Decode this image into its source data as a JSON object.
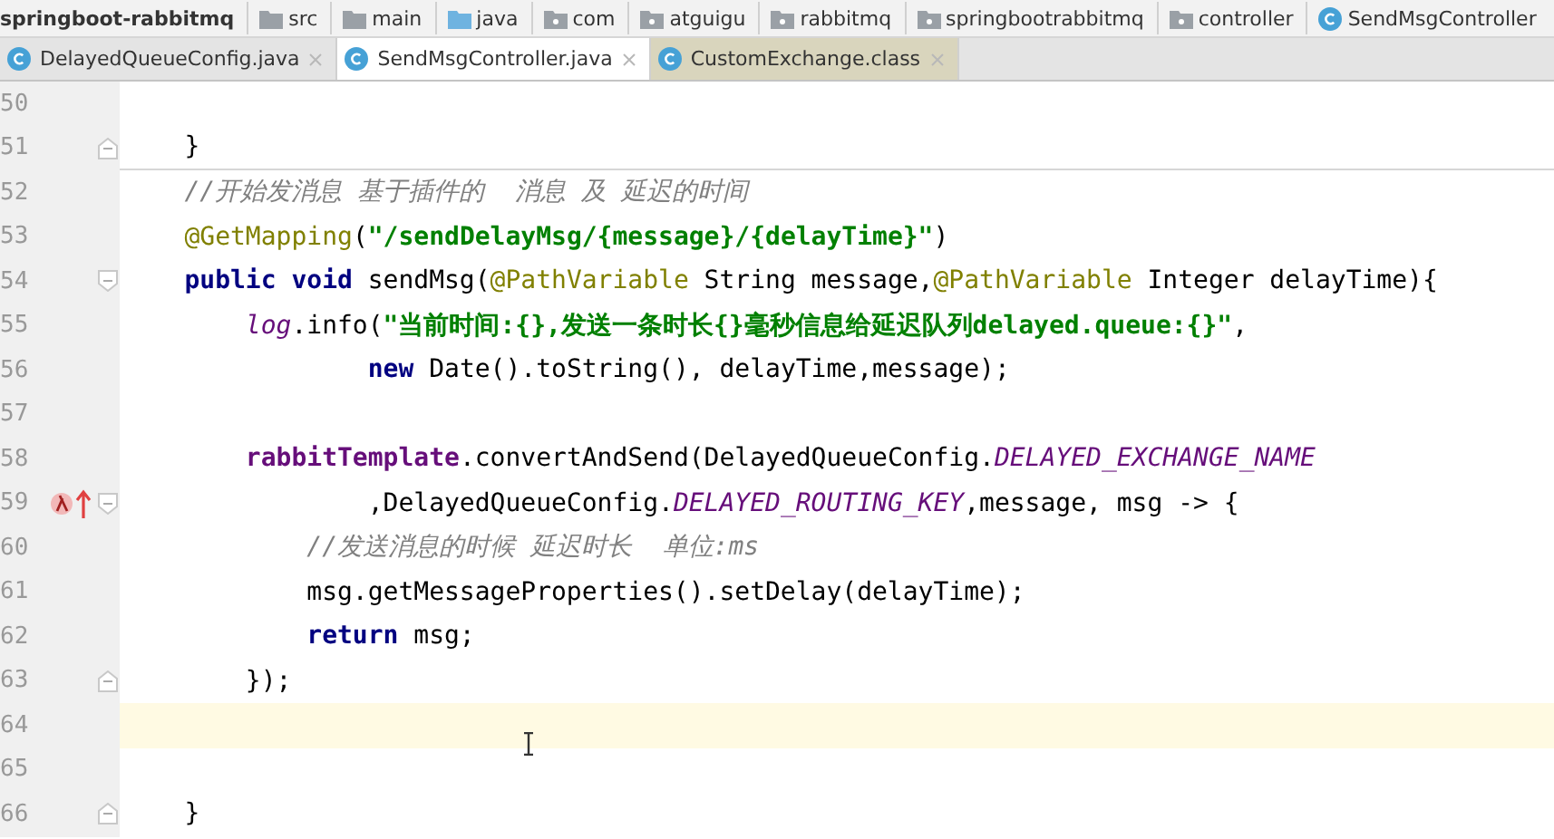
{
  "breadcrumb": [
    {
      "label": "springboot-rabbitmq",
      "kind": "project"
    },
    {
      "label": "src",
      "kind": "folder"
    },
    {
      "label": "main",
      "kind": "folder"
    },
    {
      "label": "java",
      "kind": "source_folder"
    },
    {
      "label": "com",
      "kind": "package"
    },
    {
      "label": "atguigu",
      "kind": "package"
    },
    {
      "label": "rabbitmq",
      "kind": "package"
    },
    {
      "label": "springbootrabbitmq",
      "kind": "package"
    },
    {
      "label": "controller",
      "kind": "package"
    },
    {
      "label": "SendMsgController",
      "kind": "class"
    }
  ],
  "tabs": [
    {
      "label": "DelayedQueueConfig.java",
      "kind": "source",
      "selected": false
    },
    {
      "label": "SendMsgController.java",
      "kind": "source",
      "selected": true
    },
    {
      "label": "CustomExchange.class",
      "kind": "library",
      "selected": false
    }
  ],
  "editor": {
    "lines": [
      {
        "number": "50",
        "current": false
      },
      {
        "number": "51",
        "current": false,
        "fold_end": true,
        "separator": true,
        "tokens": [
          {
            "text": "    }",
            "kind": "plain"
          }
        ]
      },
      {
        "number": "52",
        "current": false,
        "tokens": [
          {
            "text": "    //开始发消息 基于插件的  消息 及 延迟的时间",
            "kind": "comment"
          }
        ]
      },
      {
        "number": "53",
        "current": false,
        "tokens": [
          {
            "text": "    @GetMapping",
            "kind": "annotation"
          },
          {
            "text": "(",
            "kind": "plain"
          },
          {
            "text": "\"/sendDelayMsg/{message}/{delayTime}\"",
            "kind": "string"
          },
          {
            "text": ")",
            "kind": "plain"
          }
        ]
      },
      {
        "number": "54",
        "current": false,
        "fold_start": true,
        "tokens": [
          {
            "text": "    public void ",
            "kind": "keyword"
          },
          {
            "text": "sendMsg(",
            "kind": "plain"
          },
          {
            "text": "@PathVariable",
            "kind": "annotation"
          },
          {
            "text": " String message,",
            "kind": "plain"
          },
          {
            "text": "@PathVariable",
            "kind": "annotation"
          },
          {
            "text": " Integer delayTime){",
            "kind": "plain"
          }
        ]
      },
      {
        "number": "55",
        "current": false,
        "tokens": [
          {
            "text": "        log",
            "kind": "static"
          },
          {
            "text": ".info(",
            "kind": "plain"
          },
          {
            "text": "\"当前时间:{},发送一条时长{}毫秒信息给延迟队列delayed.queue:{}\"",
            "kind": "string"
          },
          {
            "text": ",",
            "kind": "plain"
          }
        ]
      },
      {
        "number": "56",
        "current": false,
        "tokens": [
          {
            "text": "                new",
            "kind": "keyword"
          },
          {
            "text": " Date().toString(), delayTime,message);",
            "kind": "plain"
          }
        ]
      },
      {
        "number": "57",
        "current": false
      },
      {
        "number": "58",
        "current": false,
        "tokens": [
          {
            "text": "        rabbitTemplate",
            "kind": "field"
          },
          {
            "text": ".convertAndSend(DelayedQueueConfig.",
            "kind": "plain"
          },
          {
            "text": "DELAYED_EXCHANGE_NAME",
            "kind": "static"
          }
        ]
      },
      {
        "number": "59",
        "current": false,
        "fold_start": true,
        "lambda": true,
        "tokens": [
          {
            "text": "                ,DelayedQueueConfig.",
            "kind": "plain"
          },
          {
            "text": "DELAYED_ROUTING_KEY",
            "kind": "static"
          },
          {
            "text": ",message, msg -> {",
            "kind": "plain"
          }
        ]
      },
      {
        "number": "60",
        "current": false,
        "tokens": [
          {
            "text": "            //发送消息的时候 延迟时长  单位:ms",
            "kind": "comment"
          }
        ]
      },
      {
        "number": "61",
        "current": false,
        "tokens": [
          {
            "text": "            msg.getMessageProperties().setDelay(delayTime);",
            "kind": "plain"
          }
        ]
      },
      {
        "number": "62",
        "current": false,
        "tokens": [
          {
            "text": "            return",
            "kind": "keyword"
          },
          {
            "text": " msg;",
            "kind": "plain"
          }
        ]
      },
      {
        "number": "63",
        "current": false,
        "fold_end": true,
        "tokens": [
          {
            "text": "        });",
            "kind": "plain"
          }
        ]
      },
      {
        "number": "64",
        "current": true
      },
      {
        "number": "65",
        "current": false
      },
      {
        "number": "66",
        "current": false,
        "fold_end": true,
        "tokens": [
          {
            "text": "    }",
            "kind": "plain"
          }
        ]
      }
    ]
  }
}
